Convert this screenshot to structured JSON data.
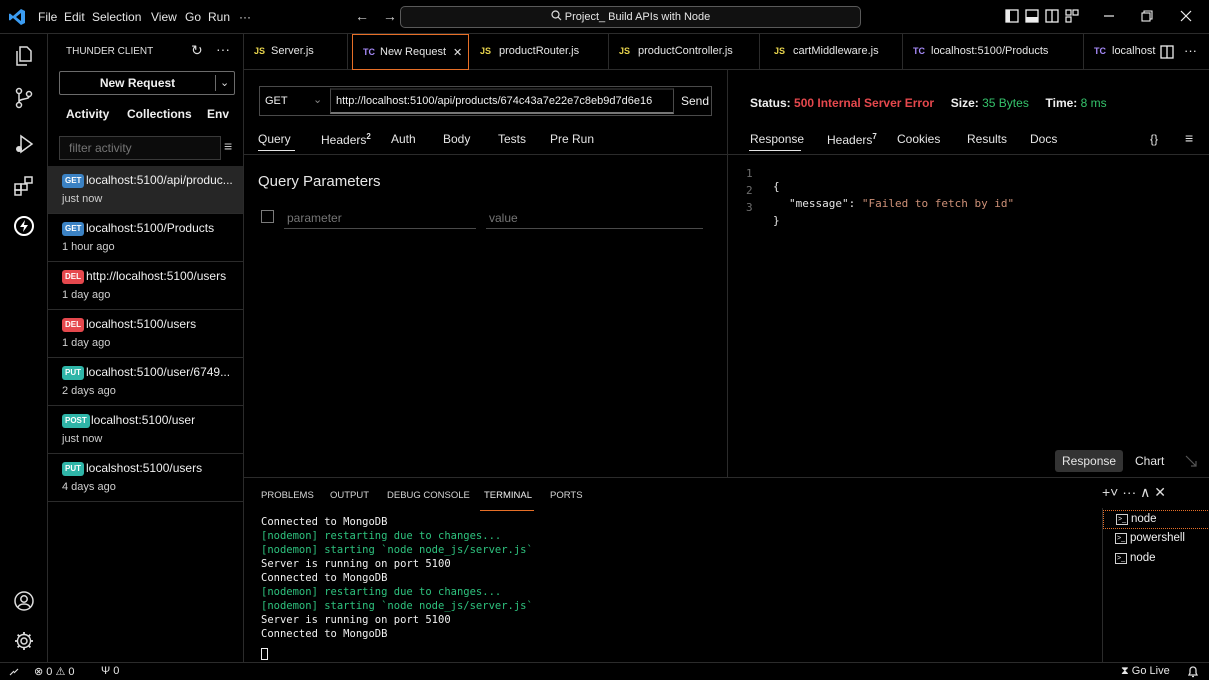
{
  "title_bar": {
    "menu": [
      "File",
      "Edit",
      "Selection",
      "View",
      "Go",
      "Run",
      "···"
    ],
    "search_text": "Project_ Build APIs with Node",
    "nav_back": "←",
    "nav_forward": "→"
  },
  "sidebar": {
    "title": "THUNDER CLIENT",
    "new_request_label": "New Request",
    "tabs": [
      "Activity",
      "Collections",
      "Env"
    ],
    "filter_placeholder": "filter activity",
    "items": [
      {
        "method": "GET",
        "url": "localhost:5100/api/produc...",
        "time": "just now",
        "color": "#3b82c4"
      },
      {
        "method": "GET",
        "url": "localhost:5100/Products",
        "time": "1 hour ago",
        "color": "#3b82c4"
      },
      {
        "method": "DEL",
        "url": "http://localhost:5100/users",
        "time": "1 day ago",
        "color": "#e5484d"
      },
      {
        "method": "DEL",
        "url": "localhost:5100/users",
        "time": "1 day ago",
        "color": "#e5484d"
      },
      {
        "method": "PUT",
        "url": "localhost:5100/user/6749...",
        "time": "2 days ago",
        "color": "#2fb5a8"
      },
      {
        "method": "POST",
        "url": "localhost:5100/user",
        "time": "just now",
        "color": "#2fb5a8"
      },
      {
        "method": "PUT",
        "url": "localshost:5100/users",
        "time": "4 days ago",
        "color": "#2fb5a8"
      }
    ]
  },
  "editor_tabs": [
    {
      "icon": "JS",
      "name": "Server.js"
    },
    {
      "icon": "TC",
      "name": "New Request",
      "close": "✕"
    },
    {
      "icon": "JS",
      "name": "productRouter.js"
    },
    {
      "icon": "JS",
      "name": "productController.js"
    },
    {
      "icon": "JS",
      "name": "cartMiddleware.js"
    },
    {
      "icon": "TC",
      "name": "localhost:5100/Products"
    },
    {
      "icon": "TC",
      "name": "localhost:"
    }
  ],
  "request": {
    "method": "GET",
    "url": "http://localhost:5100/api/products/674c43a7e22e7c8eb9d7d6e16",
    "send_label": "Send",
    "tabs": {
      "query": "Query",
      "headers": "Headers",
      "headers_count": "2",
      "auth": "Auth",
      "body": "Body",
      "tests": "Tests",
      "pre_run": "Pre Run"
    },
    "query_params_title": "Query Parameters",
    "param_placeholder": "parameter",
    "value_placeholder": "value"
  },
  "response": {
    "status_label": "Status:",
    "status_value": "500 Internal Server Error",
    "size_label": "Size:",
    "size_value": "35 Bytes",
    "time_label": "Time:",
    "time_value": "8 ms",
    "tabs": {
      "response": "Response",
      "headers": "Headers",
      "headers_count": "7",
      "cookies": "Cookies",
      "results": "Results",
      "docs": "Docs"
    },
    "braces_btn": "{}",
    "lines": [
      {
        "n": "1",
        "open": "{"
      },
      {
        "n": "2",
        "key": "\"message\"",
        "colon": ": ",
        "value": "\"Failed to fetch by id\""
      },
      {
        "n": "3",
        "close": "}"
      }
    ],
    "toggle_response": "Response",
    "toggle_chart": "Chart"
  },
  "panel": {
    "tabs": [
      "PROBLEMS",
      "OUTPUT",
      "DEBUG CONSOLE",
      "TERMINAL",
      "PORTS"
    ],
    "actions": "+˅  ···  ∧  ✕",
    "terminal_lines": [
      {
        "text": "Connected to MongoDB",
        "green": false
      },
      {
        "text": "[nodemon] restarting due to changes...",
        "green": true
      },
      {
        "text": "[nodemon] starting `node node_js/server.js`",
        "green": true
      },
      {
        "text": "Server is running on port 5100",
        "green": false
      },
      {
        "text": "Connected to MongoDB",
        "green": false
      },
      {
        "text": "[nodemon] restarting due to changes...",
        "green": true
      },
      {
        "text": "[nodemon] starting `node node_js/server.js`",
        "green": true
      },
      {
        "text": "Server is running on port 5100",
        "green": false
      },
      {
        "text": "Connected to MongoDB",
        "green": false
      }
    ],
    "terminals": [
      "node",
      "powershell",
      "node"
    ]
  },
  "status_bar": {
    "errors": "0",
    "warnings": "0",
    "ports": "0",
    "go_live": "Go Live"
  }
}
